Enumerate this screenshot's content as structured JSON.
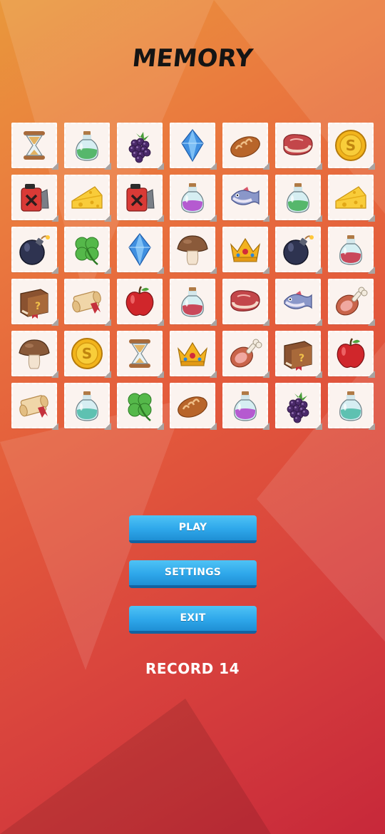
{
  "title": "MEMORY",
  "tiles": [
    [
      "hourglass-icon",
      "green-potion-icon",
      "blackberry-icon",
      "blue-gem-icon",
      "bread-icon",
      "steak-icon",
      "gold-coin-icon"
    ],
    [
      "fuel-can-icon",
      "cheese-icon",
      "fuel-can-icon",
      "purple-potion-icon",
      "fish-icon",
      "green-potion-icon",
      "cheese-icon"
    ],
    [
      "bomb-icon",
      "clover-icon",
      "blue-gem-icon",
      "mushroom-icon",
      "crown-icon",
      "bomb-icon",
      "red-potion-icon"
    ],
    [
      "spellbook-icon",
      "scroll-icon",
      "apple-icon",
      "red-potion-icon",
      "steak-icon",
      "fish-icon",
      "ham-leg-icon"
    ],
    [
      "mushroom-icon",
      "gold-coin-icon",
      "hourglass-icon",
      "crown-icon",
      "ham-leg-icon",
      "spellbook-icon",
      "apple-icon"
    ],
    [
      "scroll-icon",
      "teal-potion-icon",
      "clover-icon",
      "bread-icon",
      "purple-potion-icon",
      "blackberry-icon",
      "teal-potion-icon"
    ]
  ],
  "buttons": {
    "play": "PLAY",
    "settings": "SETTINGS",
    "exit": "EXIT"
  },
  "record": "RECORD 14",
  "colors": {
    "button": "#2ea7ea",
    "button_shadow": "#1462a0",
    "card": "#fbf3ef"
  }
}
